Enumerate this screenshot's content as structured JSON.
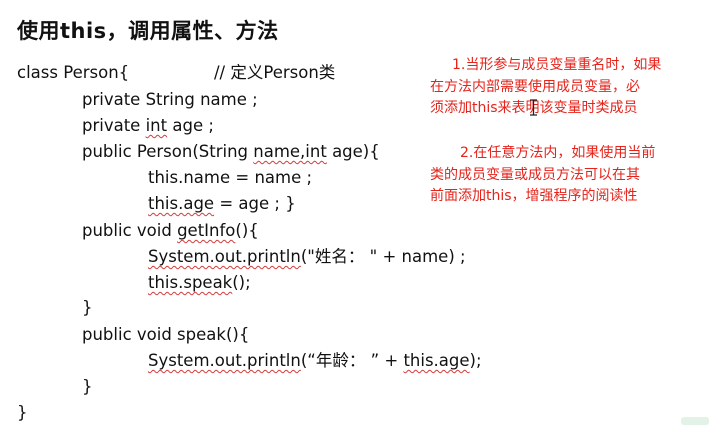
{
  "slide": {
    "title": "使用this，调用属性、方法"
  },
  "code": {
    "class_decl": "class Person{",
    "class_comment": "// 定义Person类",
    "field_name_prefix": "private String name ;",
    "field_age_prefix": "private ",
    "field_age_type": "int",
    "field_age_suffix": " age ;",
    "ctor_prefix": "public Person(String ",
    "ctor_params": "name,int",
    "ctor_suffix": " age){",
    "assign_name": "this.name = name ;",
    "assign_age_ref": "this.age",
    "assign_age_rest": " = age ;  }",
    "getinfo_prefix": "public void ",
    "getinfo_name": "getInfo",
    "getinfo_suffix": "(){",
    "println1_call": "System.out.println",
    "println1_args": "(\"姓名： \" + name) ;",
    "speak_call_ref": "this.speak",
    "speak_call_rest": "();",
    "close_brace_1": "}",
    "speak_decl": "public void speak(){",
    "println2_call": "System.out.println",
    "println2_args_a": "(“年龄： ” + ",
    "println2_args_ref": "this.age",
    "println2_args_b": ");",
    "close_brace_2": "}",
    "close_brace_class": "}"
  },
  "notes": {
    "note1_lines": [
      "1.当形参与成员变量重名时，如果",
      "在方法内部需要使用成员变量，必",
      "须添加this来表明该变量时类成员"
    ],
    "note2_lines": [
      "2.在任意方法内，如果使用当前",
      "类的成员变量或成员方法可以在其",
      "前面添加this，增强程序的阅读性"
    ]
  },
  "colors": {
    "note_text": "#e5231b",
    "code_text": "#111111",
    "squiggle": "#d23b3b",
    "background": "#ffffff"
  }
}
